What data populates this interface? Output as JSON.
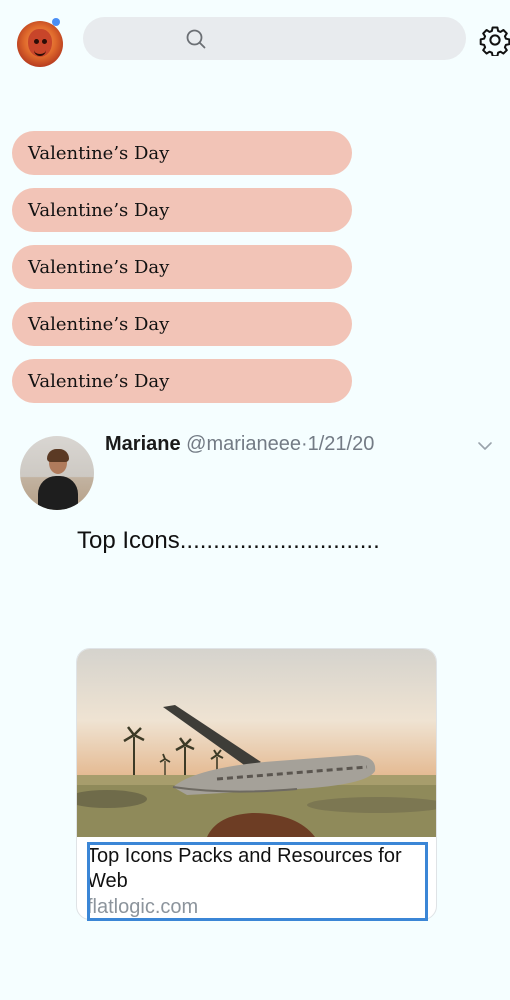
{
  "header": {
    "search_placeholder": "",
    "icons": {
      "avatar": "user-avatar",
      "search": "search-icon",
      "settings": "gear-icon"
    },
    "notification_color": "#4a8ef5"
  },
  "chips": [
    {
      "label": "Valentine’s Day"
    },
    {
      "label": "Valentine’s Day"
    },
    {
      "label": "Valentine’s Day"
    },
    {
      "label": "Valentine’s Day"
    },
    {
      "label": "Valentine’s Day"
    }
  ],
  "chip_color": "#f2c4b7",
  "tweet": {
    "name": "Mariane",
    "handle": "@marianeee",
    "date": "·1/21/20",
    "text": "Top Icons..............................",
    "card": {
      "title": "Top Icons Packs and Resources for Web",
      "domain": "flatlogic.com"
    }
  },
  "accent_color": "#3b86d6"
}
